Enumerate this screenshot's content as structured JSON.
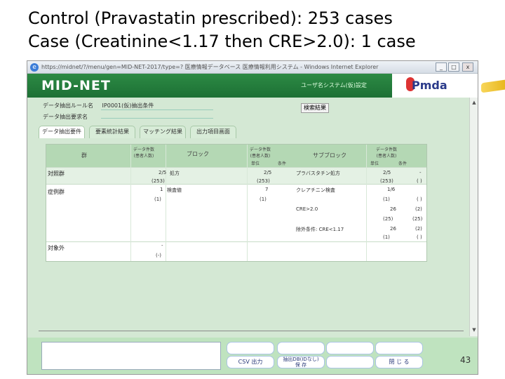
{
  "slide": {
    "title_line1": "Control (Pravastatin prescribed): 253 cases",
    "title_line2": "Case (Creatinine<1.17 then CRE>2.0): 1 case",
    "page_number": "43"
  },
  "window": {
    "title": "https://midnet/?/menu/gen=MID-NET-2017/type=? 医療情報データベース 医療情報利用システム - Windows Internet Explorer",
    "min": "_",
    "max": "□",
    "close": "x"
  },
  "header": {
    "brand": "MID-NET",
    "system": "ユーザ名システム(仮)設定",
    "logo": "Pmda"
  },
  "form": {
    "extract_label": "データ抽出ルール名",
    "extract_value": "IP0001(仮)抽出条件",
    "name_label": "データ抽出要求名",
    "name_value": "",
    "detail_button": "検索結果"
  },
  "tabs": [
    "データ抽出要件",
    "要素統計結果",
    "マッチング結果",
    "出力項目画面"
  ],
  "grid": {
    "headers": [
      "群",
      "データ件数\n(患者人数)",
      "ブロック",
      "データ件数\n(患者人数)",
      "サブブロック",
      "データ件数\n(患者人数)"
    ],
    "subheaders": [
      "単位",
      "条件",
      "単位",
      "条件"
    ],
    "groups": [
      {
        "label": "対照群",
        "rows": [
          {
            "count": "2/5",
            "block": "処方",
            "count2": "2/5",
            "sub": "プラバスタチン処方",
            "count3": "2/5",
            "cond": "-"
          },
          {
            "count": "(253)",
            "block": "",
            "count2": "(253)",
            "sub": "",
            "count3": "(253)",
            "cond": "( )"
          }
        ]
      },
      {
        "label": "症例群",
        "rows": [
          {
            "count": "1",
            "block": "検査値",
            "count2": "7",
            "sub": "クレアチニン検査",
            "count3": "1/6",
            "cond": ""
          },
          {
            "count": "(1)",
            "block": "",
            "count2": "(1)",
            "sub": "",
            "count3": "(1)",
            "cond": "( )"
          },
          {
            "count": "",
            "block": "",
            "count2": "",
            "sub": "CRE>2.0",
            "count3": "26",
            "cond": "(2)"
          },
          {
            "count": "",
            "block": "",
            "count2": "",
            "sub": "",
            "count3": "(25)",
            "cond": "(25)"
          },
          {
            "count": "",
            "block": "",
            "count2": "",
            "sub": "除外条件: CRE<1.17",
            "count3": "26",
            "cond": "(2)"
          },
          {
            "count": "",
            "block": "",
            "count2": "",
            "sub": "",
            "count3": "(1)",
            "cond": "( )"
          }
        ]
      },
      {
        "label": "対象外",
        "rows": [
          {
            "count": "-",
            "block": "",
            "count2": "",
            "sub": "",
            "count3": "",
            "cond": ""
          },
          {
            "count": "(-)",
            "block": "",
            "count2": "",
            "sub": "",
            "count3": "",
            "cond": ""
          }
        ]
      }
    ]
  },
  "footer": {
    "csv_button": "CSV 出力",
    "dbstore_button": "抽出DB(IDなし)\n保 存",
    "close_button": "閉 じ る"
  },
  "colors": {
    "header_green": "#1d7035",
    "panel_green": "#d4e8d4",
    "grid_header": "#b4d8b4",
    "pointer": "#e8b820"
  }
}
